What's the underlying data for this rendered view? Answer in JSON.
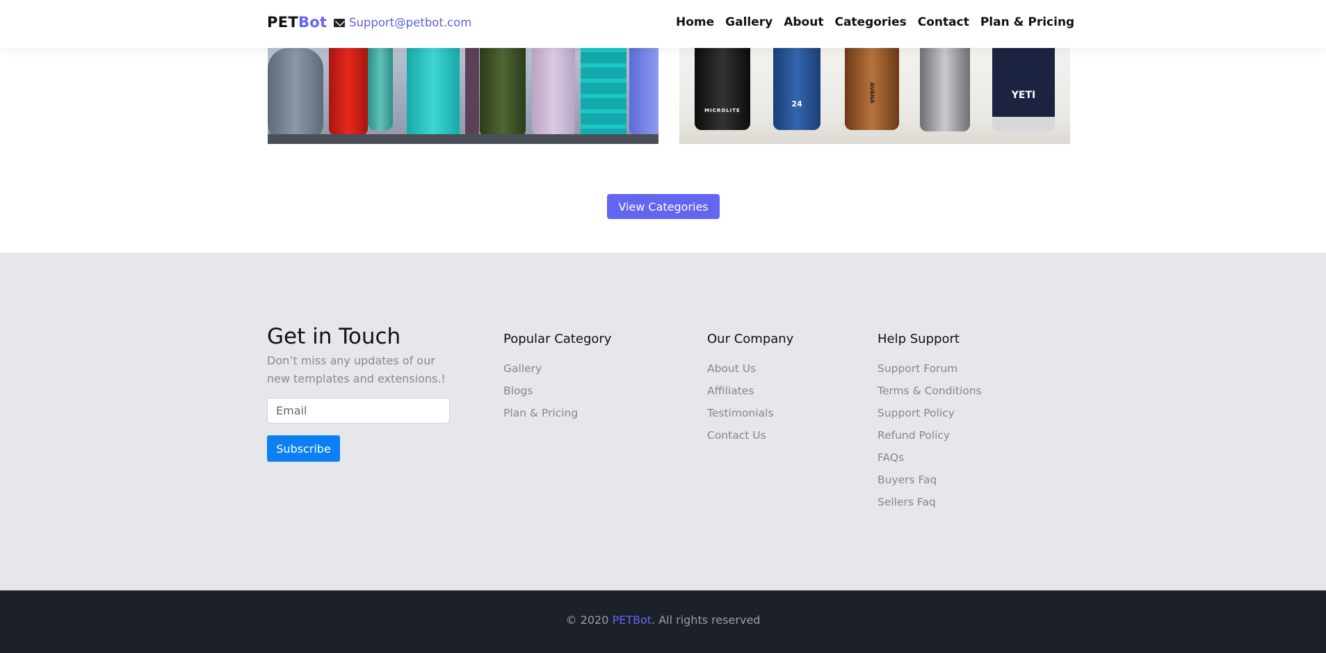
{
  "nav": {
    "brand_part1": "PET",
    "brand_part2": "Bot",
    "support_email": "Support@petbot.com",
    "links": [
      "Home",
      "Gallery",
      "About",
      "Categories",
      "Contact",
      "Plan & Pricing"
    ]
  },
  "images": {
    "left_alt": "water bottles",
    "right_alt": "water bottles",
    "right_labels": [
      "MICROLITE",
      "24",
      "AVANA",
      "YETI"
    ]
  },
  "view_categories_label": "View Categories",
  "footer": {
    "get_in_touch": {
      "title": "Get in Touch",
      "description": "Don’t miss any updates of our new templates and extensions.!",
      "email_placeholder": "Email",
      "subscribe_label": "Subscribe"
    },
    "popular_category": {
      "title": "Popular Category",
      "links": [
        "Gallery",
        "Blogs",
        "Plan & Pricing"
      ]
    },
    "our_company": {
      "title": "Our Company",
      "links": [
        "About Us",
        "Affiliates",
        "Testimonials",
        "Contact Us"
      ]
    },
    "help_support": {
      "title": "Help Support",
      "links": [
        "Support Forum",
        "Terms & Conditions",
        "Support Policy",
        "Refund Policy",
        "FAQs",
        "Buyers Faq",
        "Sellers Faq"
      ]
    }
  },
  "copyright": {
    "prefix": "© 2020 ",
    "brand": "PETBot",
    "suffix": ". All rights reserved"
  },
  "colors": {
    "accent": "#6366f1",
    "subscribe": "#0d7ff5",
    "footer_bg": "#e5e7eb",
    "bottom_bar": "#1c2028"
  }
}
